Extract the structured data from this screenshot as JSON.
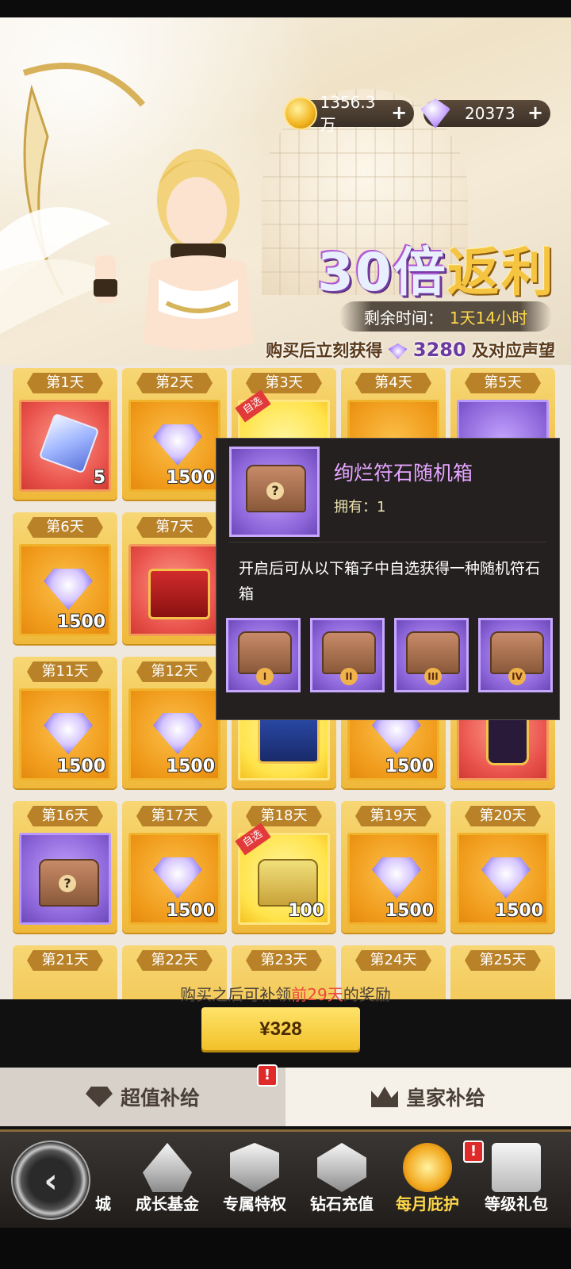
{
  "currency": {
    "coins": "1356.3万",
    "gems": "20373",
    "plus": "+"
  },
  "promo": {
    "title_part1": "30倍",
    "title_part2": "返利",
    "timer_label": "剩余时间：",
    "timer_value": "1天14小时",
    "sub_prefix": "购买后立刻获得",
    "sub_amount": "3280",
    "sub_suffix": "及对应声望"
  },
  "days": [
    {
      "day": "第1天",
      "qty": "5",
      "bg": "red",
      "icon": "crystal-cube-icon"
    },
    {
      "day": "第2天",
      "qty": "1500",
      "bg": "orange",
      "icon": "diamond-icon"
    },
    {
      "day": "第3天",
      "qty": "",
      "bg": "gold",
      "icon": "chest-icon",
      "tag": "自选"
    },
    {
      "day": "第4天",
      "qty": "",
      "bg": "orange",
      "icon": "diamond-icon"
    },
    {
      "day": "第5天",
      "qty": "",
      "bg": "purple",
      "icon": "rune-chest-icon"
    },
    {
      "day": "第6天",
      "qty": "1500",
      "bg": "orange",
      "icon": "diamond-icon"
    },
    {
      "day": "第7天",
      "qty": "",
      "bg": "red",
      "icon": "crown-chest-icon"
    },
    {
      "day": "第11天",
      "qty": "1500",
      "bg": "orange",
      "icon": "diamond-icon"
    },
    {
      "day": "第12天",
      "qty": "1500",
      "bg": "orange",
      "icon": "diamond-icon"
    },
    {
      "day": "",
      "qty": "",
      "bg": "gold",
      "icon": "chest-icon",
      "tag": "自选"
    },
    {
      "day": "",
      "qty": "1500",
      "bg": "orange",
      "icon": "diamond-icon"
    },
    {
      "day": "",
      "qty": "",
      "bg": "red",
      "icon": "helmet-card-icon"
    },
    {
      "day": "第16天",
      "qty": "",
      "bg": "purple",
      "icon": "rune-chest-icon"
    },
    {
      "day": "第17天",
      "qty": "1500",
      "bg": "orange",
      "icon": "diamond-icon"
    },
    {
      "day": "第18天",
      "qty": "100",
      "bg": "gold",
      "icon": "badge-chest-icon",
      "tag": "自选"
    },
    {
      "day": "第19天",
      "qty": "1500",
      "bg": "orange",
      "icon": "diamond-icon"
    },
    {
      "day": "第20天",
      "qty": "1500",
      "bg": "orange",
      "icon": "diamond-icon"
    },
    {
      "day": "第21天",
      "qty": "",
      "bg": "orange",
      "icon": ""
    },
    {
      "day": "第22天",
      "qty": "",
      "bg": "orange",
      "icon": ""
    },
    {
      "day": "第23天",
      "qty": "",
      "bg": "orange",
      "icon": ""
    },
    {
      "day": "第24天",
      "qty": "",
      "bg": "orange",
      "icon": ""
    },
    {
      "day": "第25天",
      "qty": "",
      "bg": "orange",
      "icon": ""
    }
  ],
  "tooltip": {
    "name": "绚烂符石随机箱",
    "owned": "拥有：1",
    "desc": "开启后可从以下箱子中自选获得一种随机符石箱",
    "options": [
      "I",
      "II",
      "III",
      "IV"
    ]
  },
  "purchase": {
    "info_prefix": "购买之后可补领",
    "info_highlight": "前29天",
    "info_suffix": "的奖励",
    "price": "¥328"
  },
  "tabs": {
    "left": "超值补给",
    "right": "皇家补给",
    "badge": "!"
  },
  "nav": {
    "items": [
      "城",
      "成长基金",
      "专属特权",
      "钻石充值",
      "每月庇护",
      "等级礼包"
    ],
    "badge": "!"
  }
}
